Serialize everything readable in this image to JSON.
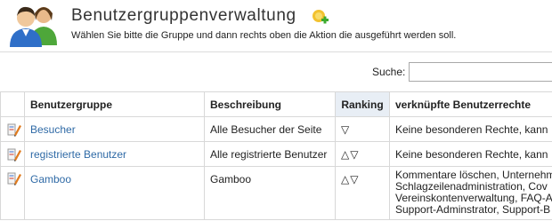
{
  "header": {
    "title": "Benutzergruppenverwaltung",
    "subtitle": "Wählen Sie bitte die Gruppe und dann rechts oben die Aktion die ausgeführt werden soll.",
    "icon": "users-icon",
    "add_icon": "add-group-icon"
  },
  "search": {
    "label": "Suche:",
    "value": ""
  },
  "table": {
    "columns": [
      "",
      "Benutzergruppe",
      "Beschreibung",
      "Ranking",
      "verknüpfte Benutzerrechte"
    ],
    "rows": [
      {
        "group": "Besucher",
        "description": "Alle Besucher der Seite",
        "ranking_up": "",
        "ranking_down": "▽",
        "rights": "Keine besonderen Rechte, kann"
      },
      {
        "group": "registrierte Benutzer",
        "description": "Alle registrierte Benutzer",
        "ranking_up": "△",
        "ranking_down": "▽",
        "rights": "Keine besonderen Rechte, kann"
      },
      {
        "group": "Gamboo",
        "description": "Gamboo",
        "ranking_up": "△",
        "ranking_down": "▽",
        "rights_lines": [
          "Kommentare löschen, Unternehm",
          "Schlagzeilenadministration, Cov",
          "Vereinskontenverwaltung, FAQ-A",
          "Support-Adminstrator, Support-B"
        ]
      }
    ]
  },
  "colors": {
    "link": "#2f6aa6",
    "ranking_header_bg": "#e8eef5",
    "border": "#d8d8d8"
  }
}
